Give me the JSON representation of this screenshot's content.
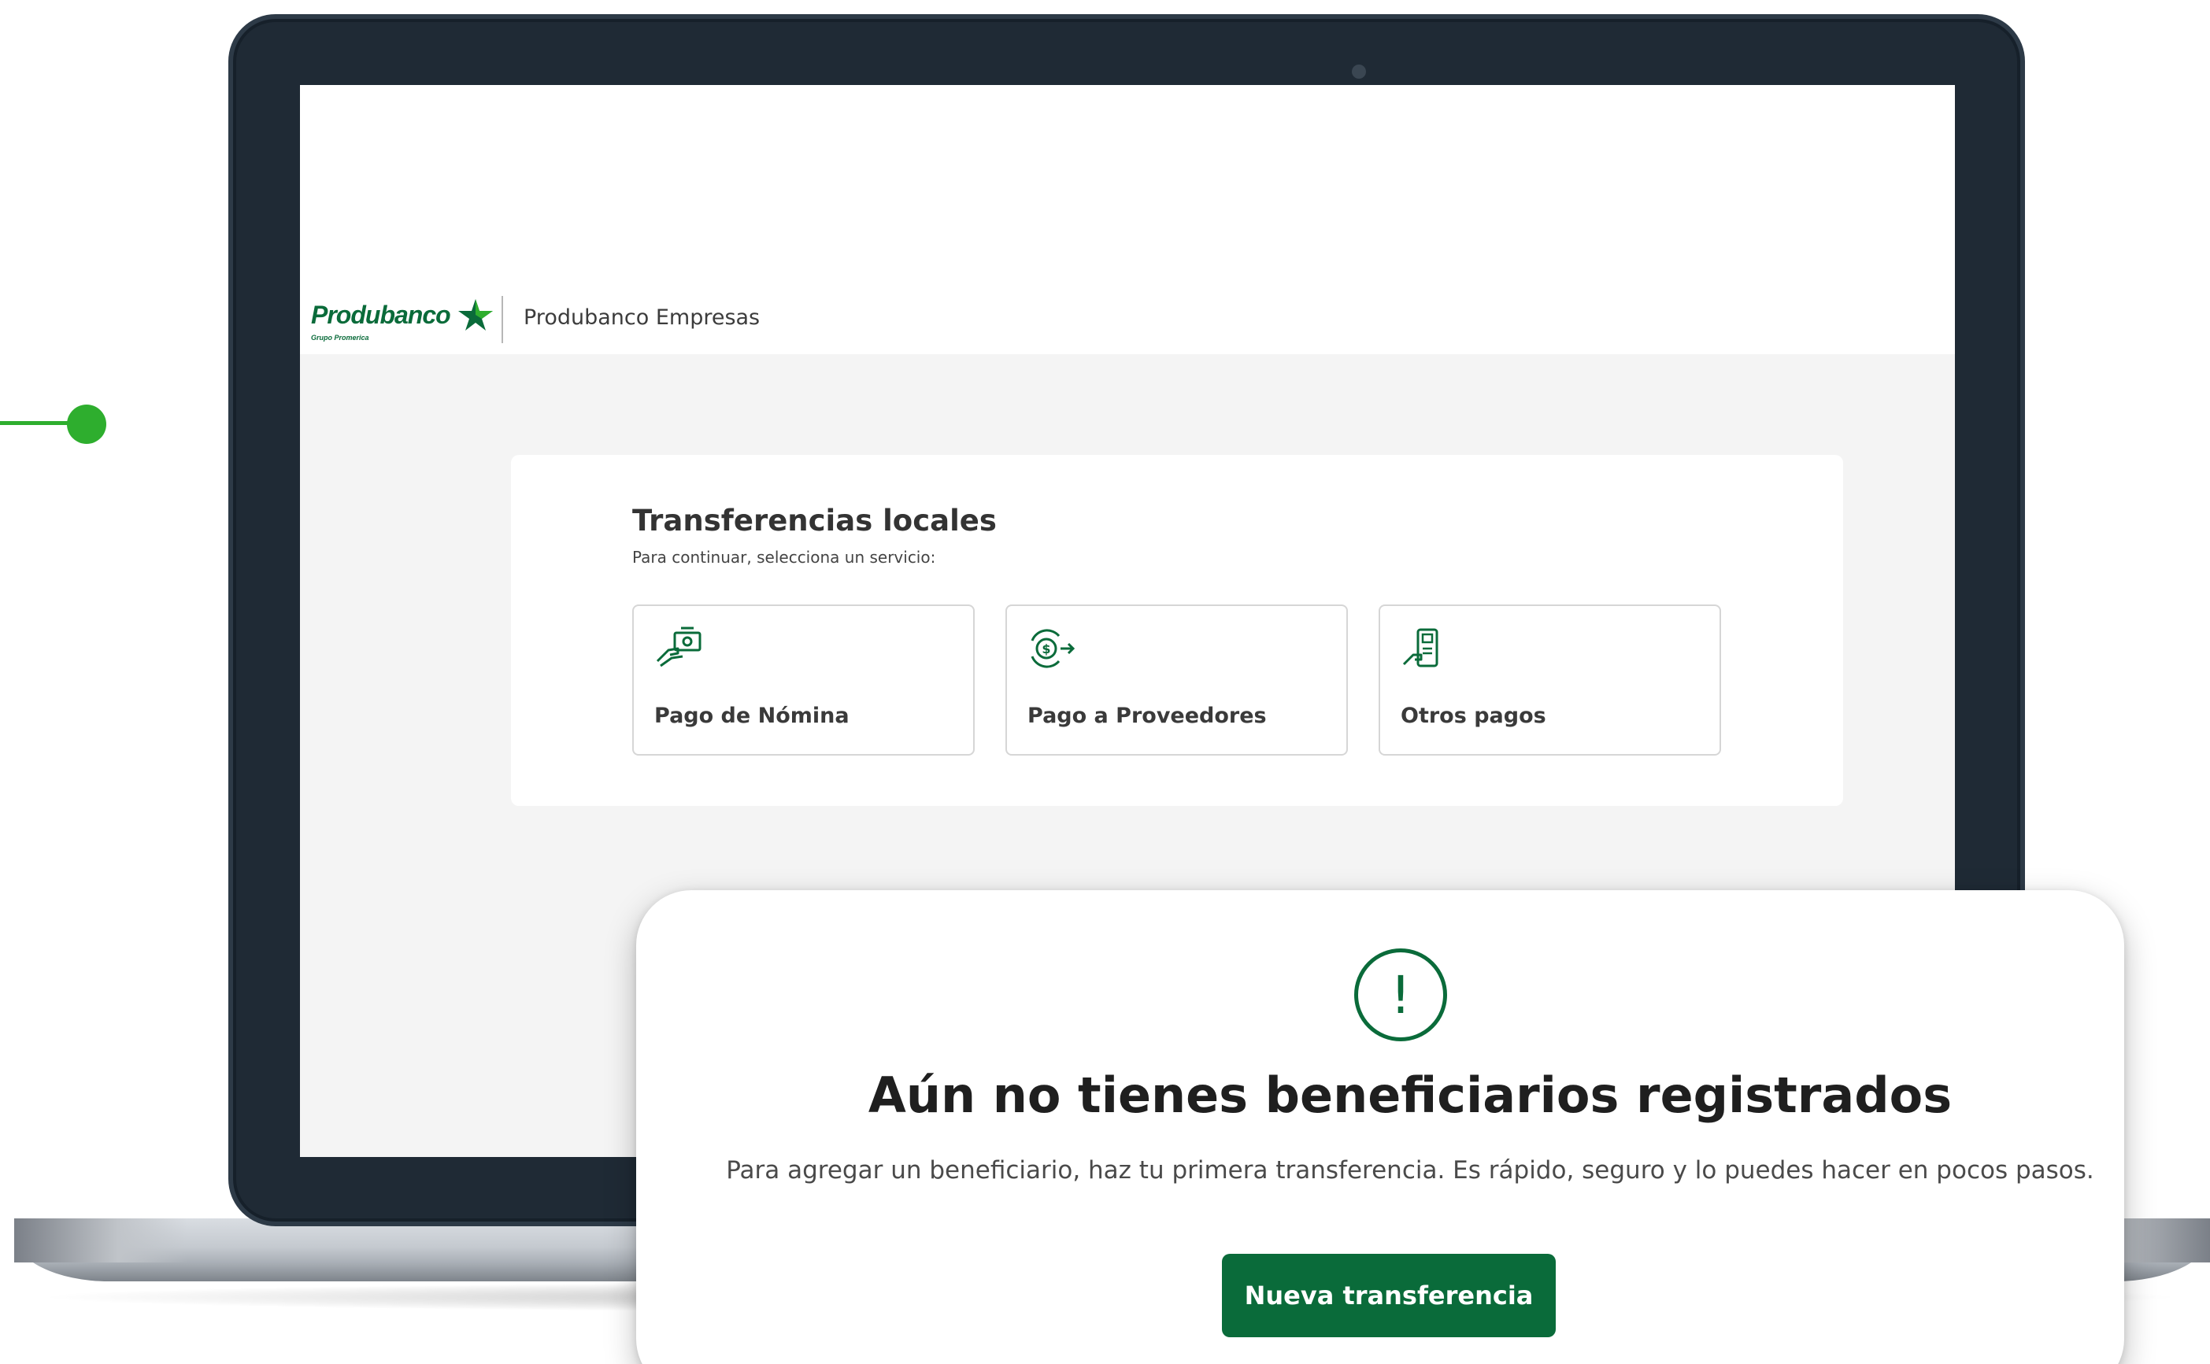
{
  "brand": {
    "logo_text": "Produbanco",
    "logo_subtext": "Grupo Promerica",
    "app_name": "Produbanco Empresas",
    "primary_color": "#0a6b3a",
    "accent_color": "#2eae2e"
  },
  "panel": {
    "title": "Transferencias locales",
    "subtitle": "Para continuar, selecciona un servicio:",
    "services": [
      {
        "label": "Pago de Nómina",
        "icon": "payroll-icon"
      },
      {
        "label": "Pago a Proveedores",
        "icon": "supplier-payment-icon"
      },
      {
        "label": "Otros pagos",
        "icon": "other-payments-icon"
      }
    ]
  },
  "modal": {
    "icon": "exclamation-circle-icon",
    "title": "Aún no tienes beneficiarios registrados",
    "message": "Para agregar un beneficiario, haz tu primera transferencia. Es rápido, seguro y lo puedes hacer en pocos pasos.",
    "button_label": "Nueva transferencia"
  }
}
